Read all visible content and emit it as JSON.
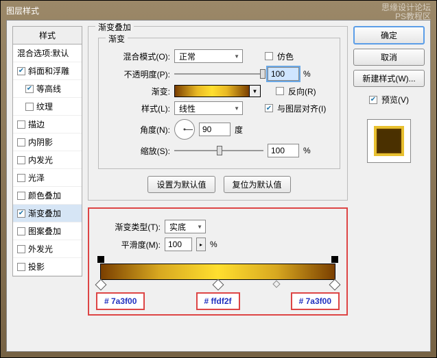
{
  "window": {
    "title": "图层样式"
  },
  "watermark": {
    "line1": "思缘设计论坛",
    "line2": "PS教程区"
  },
  "styles": {
    "header": "样式",
    "blend": "混合选项:默认",
    "items": [
      {
        "label": "斜面和浮雕",
        "checked": true,
        "sub": false
      },
      {
        "label": "等高线",
        "checked": true,
        "sub": true
      },
      {
        "label": "纹理",
        "checked": false,
        "sub": true
      },
      {
        "label": "描边",
        "checked": false,
        "sub": false
      },
      {
        "label": "内阴影",
        "checked": false,
        "sub": false
      },
      {
        "label": "内发光",
        "checked": false,
        "sub": false
      },
      {
        "label": "光泽",
        "checked": false,
        "sub": false
      },
      {
        "label": "颜色叠加",
        "checked": false,
        "sub": false
      },
      {
        "label": "渐变叠加",
        "checked": true,
        "sub": false,
        "selected": true
      },
      {
        "label": "图案叠加",
        "checked": false,
        "sub": false
      },
      {
        "label": "外发光",
        "checked": false,
        "sub": false
      },
      {
        "label": "投影",
        "checked": false,
        "sub": false
      }
    ]
  },
  "overlay": {
    "groupTitle": "渐变叠加",
    "subTitle": "渐变",
    "blendModeLabel": "混合模式(O):",
    "blendModeValue": "正常",
    "ditherLabel": "仿色",
    "opacityLabel": "不透明度(P):",
    "opacityValue": "100",
    "pct": "%",
    "gradientLabel": "渐变:",
    "reverseLabel": "反向(R)",
    "styleLabel": "样式(L):",
    "styleValue": "线性",
    "alignLabel": "与图层对齐(I)",
    "angleLabel": "角度(N):",
    "angleValue": "90",
    "angleUnit": "度",
    "scaleLabel": "缩放(S):",
    "scaleValue": "100",
    "btnSetDefault": "设置为默认值",
    "btnResetDefault": "复位为默认值"
  },
  "editor": {
    "typeLabel": "渐变类型(T):",
    "typeValue": "实底",
    "smoothLabel": "平滑度(M):",
    "smoothValue": "100",
    "pct": "%",
    "colors": {
      "left": "# 7a3f00",
      "mid": "# ffdf2f",
      "right": "# 7a3f00"
    }
  },
  "right": {
    "ok": "确定",
    "cancel": "取消",
    "newStyle": "新建样式(W)...",
    "previewLabel": "预览(V)"
  }
}
